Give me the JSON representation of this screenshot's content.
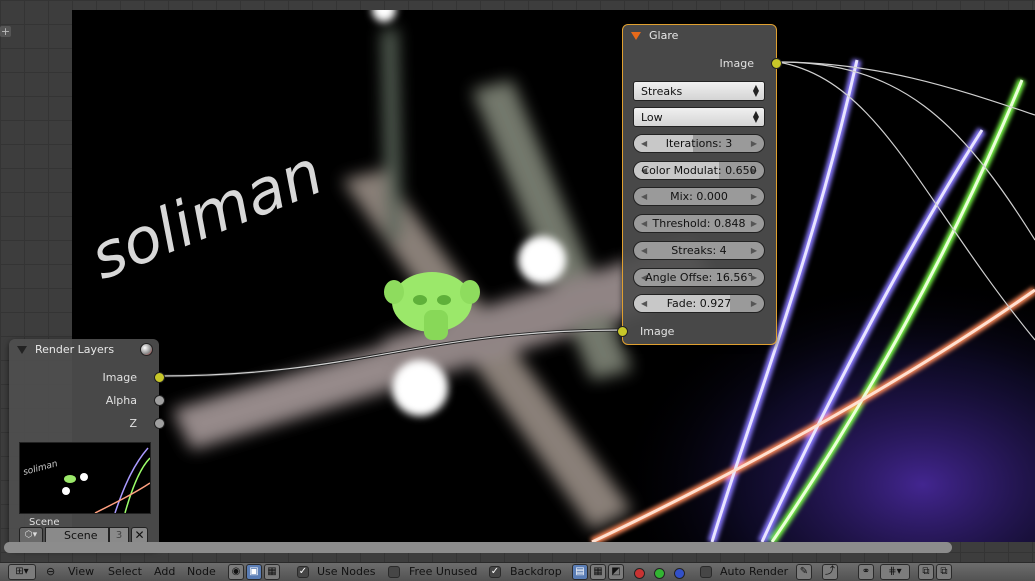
{
  "backdrop": {
    "watermark": "soliman"
  },
  "glare_node": {
    "title": "Glare",
    "output_label": "Image",
    "input_label": "Image",
    "glare_type": "Streaks",
    "quality": "Low",
    "fields": [
      {
        "label": "Iterations: 3",
        "fill": 0.45
      },
      {
        "label": "Color Modulat: 0.650",
        "fill": 0.65
      },
      {
        "label": "Mix: 0.000",
        "fill": 0.0
      },
      {
        "label": "Threshold: 0.848",
        "fill": 0.0
      },
      {
        "label": "Streaks: 4",
        "fill": 0.0
      },
      {
        "label": "Angle Offse: 16.56°",
        "fill": 0.0
      },
      {
        "label": "Fade: 0.927",
        "fill": 0.74
      }
    ]
  },
  "render_layers_node": {
    "title": "Render Layers",
    "outputs": [
      "Image",
      "Alpha",
      "Z"
    ],
    "thumbnail_text": "soliman",
    "scene_label": "Scene",
    "scene_value": "Scene",
    "layer_number": "3"
  },
  "header": {
    "menus": [
      "View",
      "Select",
      "Add",
      "Node"
    ],
    "use_nodes": "Use Nodes",
    "free_unused": "Free Unused",
    "backdrop": "Backdrop",
    "auto_render": "Auto Render"
  },
  "colors": {
    "node_bg": "#4e4e4e",
    "socket_yellow": "#c7c729",
    "glare_accent": "#e86a1a"
  }
}
